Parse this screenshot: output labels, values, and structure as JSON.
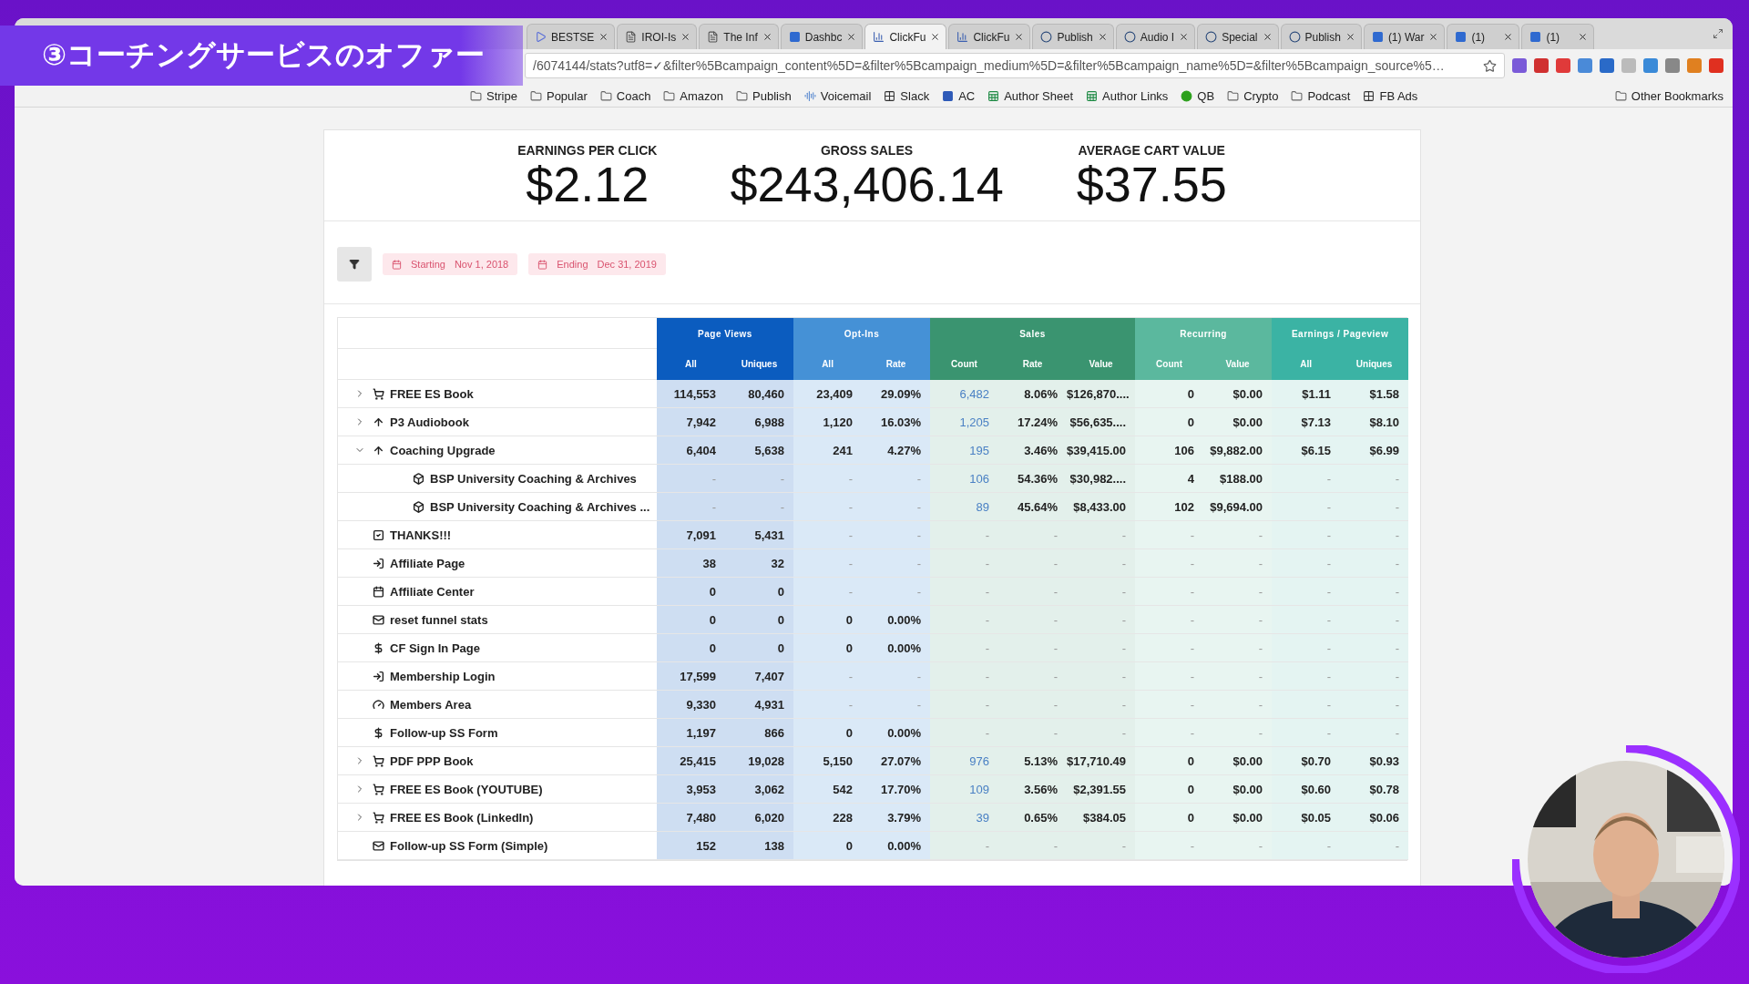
{
  "overlay_title": "③コーチングサービスのオファー",
  "browser": {
    "tabs": [
      {
        "label": "BESTSE",
        "kind": "play",
        "selected": false
      },
      {
        "label": "IROI-Is",
        "kind": "doc",
        "selected": false
      },
      {
        "label": "The Inf",
        "kind": "doc",
        "selected": false
      },
      {
        "label": "Dashbc",
        "kind": "square",
        "selected": false
      },
      {
        "label": "ClickFu",
        "kind": "chart",
        "selected": true
      },
      {
        "label": "ClickFu",
        "kind": "chart",
        "selected": false
      },
      {
        "label": "Publish",
        "kind": "circle",
        "selected": false
      },
      {
        "label": "Audio I",
        "kind": "circle",
        "selected": false
      },
      {
        "label": "Special",
        "kind": "circle",
        "selected": false
      },
      {
        "label": "Publish",
        "kind": "circle",
        "selected": false
      },
      {
        "label": "(1) War",
        "kind": "square",
        "selected": false
      },
      {
        "label": "(1)",
        "kind": "square",
        "selected": false
      },
      {
        "label": "(1)",
        "kind": "square",
        "selected": false
      }
    ],
    "address": "/6074144/stats?utf8=✓&filter%5Bcampaign_content%5D=&filter%5Bcampaign_medium%5D=&filter%5Bcampaign_name%5D=&filter%5Bcampaign_source%5…",
    "bookmarks": [
      {
        "label": "Stripe",
        "kind": "folder"
      },
      {
        "label": "Popular",
        "kind": "folder"
      },
      {
        "label": "Coach",
        "kind": "folder"
      },
      {
        "label": "Amazon",
        "kind": "folder"
      },
      {
        "label": "Publish",
        "kind": "folder"
      },
      {
        "label": "Voicemail",
        "kind": "wave"
      },
      {
        "label": "Slack",
        "kind": "grid"
      },
      {
        "label": "AC",
        "kind": "square"
      },
      {
        "label": "Author Sheet",
        "kind": "sheet"
      },
      {
        "label": "Author Links",
        "kind": "sheet"
      },
      {
        "label": "QB",
        "kind": "circle"
      },
      {
        "label": "Crypto",
        "kind": "folder"
      },
      {
        "label": "Podcast",
        "kind": "folder"
      },
      {
        "label": "FB Ads",
        "kind": "grid"
      }
    ],
    "other_bookmarks": "Other Bookmarks"
  },
  "stats": [
    {
      "label": "EARNINGS PER CLICK",
      "value": "$2.12"
    },
    {
      "label": "GROSS SALES",
      "value": "$243,406.14"
    },
    {
      "label": "AVERAGE CART VALUE",
      "value": "$37.55"
    }
  ],
  "filters": [
    {
      "label": "Starting",
      "date": "Nov 1, 2018"
    },
    {
      "label": "Ending",
      "date": "Dec 31, 2019"
    }
  ],
  "table": {
    "groups": [
      {
        "label": "Page Views",
        "color": "#0b5cbf",
        "columns": [
          "All",
          "Uniques"
        ]
      },
      {
        "label": "Opt-Ins",
        "color": "#4591d6",
        "columns": [
          "All",
          "Rate"
        ]
      },
      {
        "label": "Sales",
        "color": "#3a9470",
        "columns": [
          "Count",
          "Rate",
          "Value"
        ]
      },
      {
        "label": "Recurring",
        "color": "#5bb89e",
        "columns": [
          "Count",
          "Value"
        ]
      },
      {
        "label": "Earnings / Pageview",
        "color": "#3bb3a4",
        "columns": [
          "All",
          "Uniques"
        ]
      }
    ],
    "rows": [
      {
        "name": "FREE ES Book",
        "kind": "cart",
        "expanded": false,
        "cells": [
          "114,553",
          "80,460",
          "23,409",
          "29.09%",
          "6,482",
          "8.06%",
          "$126,870....",
          "0",
          "$0.00",
          "$1.11",
          "$1.58"
        ]
      },
      {
        "name": "P3 Audiobook",
        "kind": "up",
        "expanded": false,
        "cells": [
          "7,942",
          "6,988",
          "1,120",
          "16.03%",
          "1,205",
          "17.24%",
          "$56,635....",
          "0",
          "$0.00",
          "$7.13",
          "$8.10"
        ]
      },
      {
        "name": "Coaching Upgrade",
        "kind": "up",
        "expanded": true,
        "cells": [
          "6,404",
          "5,638",
          "241",
          "4.27%",
          "195",
          "3.46%",
          "$39,415.00",
          "106",
          "$9,882.00",
          "$6.15",
          "$6.99"
        ],
        "children": [
          {
            "name": "BSP University Coaching & Archives",
            "kind": "cube",
            "cells": [
              "-",
              "-",
              "-",
              "-",
              "106",
              "54.36%",
              "$30,982....",
              "4",
              "$188.00",
              "-",
              "-"
            ]
          },
          {
            "name": "BSP University Coaching & Archives ...",
            "kind": "cube",
            "cells": [
              "-",
              "-",
              "-",
              "-",
              "89",
              "45.64%",
              "$8,433.00",
              "102",
              "$9,694.00",
              "-",
              "-"
            ]
          }
        ]
      },
      {
        "name": "THANKS!!!",
        "kind": "check",
        "cells": [
          "7,091",
          "5,431",
          "-",
          "-",
          "-",
          "-",
          "-",
          "-",
          "-",
          "-",
          "-"
        ]
      },
      {
        "name": "Affiliate Page",
        "kind": "signin",
        "cells": [
          "38",
          "32",
          "-",
          "-",
          "-",
          "-",
          "-",
          "-",
          "-",
          "-",
          "-"
        ]
      },
      {
        "name": "Affiliate Center",
        "kind": "calendar",
        "cells": [
          "0",
          "0",
          "-",
          "-",
          "-",
          "-",
          "-",
          "-",
          "-",
          "-",
          "-"
        ]
      },
      {
        "name": "reset funnel stats",
        "kind": "mail",
        "cells": [
          "0",
          "0",
          "0",
          "0.00%",
          "-",
          "-",
          "-",
          "-",
          "-",
          "-",
          "-"
        ]
      },
      {
        "name": "CF Sign In Page",
        "kind": "dollar",
        "cells": [
          "0",
          "0",
          "0",
          "0.00%",
          "-",
          "-",
          "-",
          "-",
          "-",
          "-",
          "-"
        ]
      },
      {
        "name": "Membership Login",
        "kind": "signin",
        "cells": [
          "17,599",
          "7,407",
          "-",
          "-",
          "-",
          "-",
          "-",
          "-",
          "-",
          "-",
          "-"
        ]
      },
      {
        "name": "Members Area",
        "kind": "gauge",
        "cells": [
          "9,330",
          "4,931",
          "-",
          "-",
          "-",
          "-",
          "-",
          "-",
          "-",
          "-",
          "-"
        ]
      },
      {
        "name": "Follow-up SS Form",
        "kind": "dollar",
        "cells": [
          "1,197",
          "866",
          "0",
          "0.00%",
          "-",
          "-",
          "-",
          "-",
          "-",
          "-",
          "-"
        ]
      },
      {
        "name": "PDF PPP Book",
        "kind": "cart",
        "expanded": false,
        "cells": [
          "25,415",
          "19,028",
          "5,150",
          "27.07%",
          "976",
          "5.13%",
          "$17,710.49",
          "0",
          "$0.00",
          "$0.70",
          "$0.93"
        ]
      },
      {
        "name": "FREE ES Book (YOUTUBE)",
        "kind": "cart",
        "expanded": false,
        "cells": [
          "3,953",
          "3,062",
          "542",
          "17.70%",
          "109",
          "3.56%",
          "$2,391.55",
          "0",
          "$0.00",
          "$0.60",
          "$0.78"
        ]
      },
      {
        "name": "FREE ES Book (LinkedIn)",
        "kind": "cart",
        "expanded": false,
        "cells": [
          "7,480",
          "6,020",
          "228",
          "3.79%",
          "39",
          "0.65%",
          "$384.05",
          "0",
          "$0.00",
          "$0.05",
          "$0.06"
        ]
      },
      {
        "name": "Follow-up SS Form (Simple)",
        "kind": "mail",
        "cells": [
          "152",
          "138",
          "0",
          "0.00%",
          "-",
          "-",
          "-",
          "-",
          "-",
          "-",
          "-"
        ]
      }
    ]
  }
}
